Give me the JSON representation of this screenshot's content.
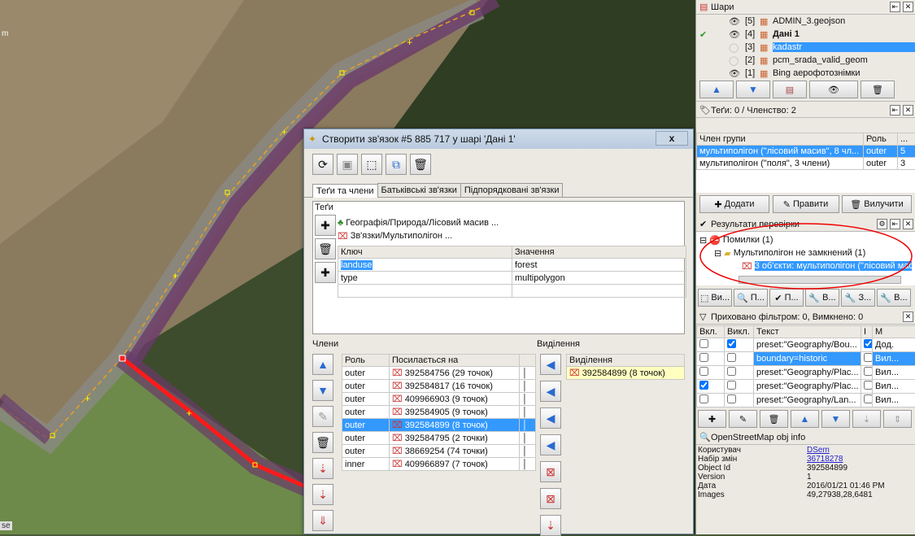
{
  "map": {
    "scale_label": "m",
    "scale_label2": "se"
  },
  "layers": {
    "title": "Шари",
    "items": [
      {
        "index": "[5]",
        "name": "ADMIN_3.geojson",
        "visible": true,
        "active": false
      },
      {
        "index": "[4]",
        "name": "Дані 1",
        "visible": true,
        "active": true
      },
      {
        "index": "[3]",
        "name": "kadastr",
        "visible": false,
        "active": false,
        "selected": true
      },
      {
        "index": "[2]",
        "name": "pcm_srada_valid_geom",
        "visible": false,
        "active": false
      },
      {
        "index": "[1]",
        "name": "Bing аерофотознімки",
        "visible": true,
        "active": false
      }
    ]
  },
  "relation_panel": {
    "title": "Теґи: 0 / Членство: 2",
    "col_member": "Член групи",
    "col_role": "Роль",
    "col_more": "...",
    "rows": [
      {
        "member": "мультиполігон (\"лісовий масив\", 8 чл...",
        "role": "outer",
        "n": "5",
        "selected": true
      },
      {
        "member": "мультиполігон (\"поля\", 3 члени)",
        "role": "outer",
        "n": "3",
        "selected": false
      }
    ],
    "add": "Додати",
    "edit": "Правити",
    "remove": "Вилучити"
  },
  "validation": {
    "title": "Результати перевірки",
    "errors": "Помилки (1)",
    "group": "Мультиполігон не замкнений (1)",
    "item": "3 об'єкти: мультиполігон (\"лісовий мас",
    "buttons": [
      "Ви...",
      "П...",
      "П...",
      "В...",
      "З...",
      "В..."
    ]
  },
  "filters": {
    "title": "Приховано фільтром: 0, Вимкнено: 0",
    "col_on": "Вкл.",
    "col_off": "Викл.",
    "col_text": "Текст",
    "col_i": "I",
    "col_m": "M",
    "rows": [
      {
        "on": false,
        "off": true,
        "text": "preset:\"Geography/Bou...",
        "i": true,
        "m": "Дод.",
        "selected": false
      },
      {
        "on": false,
        "off": false,
        "text": "boundary=historic",
        "i": false,
        "m": "Вил...",
        "selected": true
      },
      {
        "on": false,
        "off": false,
        "text": "preset:\"Geography/Plac...",
        "i": false,
        "m": "Вил...",
        "selected": false
      },
      {
        "on": true,
        "off": false,
        "text": "preset:\"Geography/Plac...",
        "i": false,
        "m": "Вил...",
        "selected": false
      },
      {
        "on": false,
        "off": false,
        "text": "preset:\"Geography/Lan...",
        "i": false,
        "m": "Вил...",
        "selected": false
      }
    ]
  },
  "objinfo": {
    "title": "OpenStreetMap obj info",
    "rows": [
      {
        "k": "Користувач",
        "v": "DSem",
        "link": true
      },
      {
        "k": "Набір змін",
        "v": "36718278",
        "link": true
      },
      {
        "k": "Object Id",
        "v": "392584899",
        "link": false
      },
      {
        "k": "Version",
        "v": "1",
        "link": false
      },
      {
        "k": "Дата",
        "v": "2016/01/21 01:46 PM",
        "link": false
      },
      {
        "k": "Images",
        "v": "49,27938,28,6481",
        "link": false
      }
    ]
  },
  "dialog": {
    "title": "Створити зв'язок #5 885 717 у шарі 'Дані 1'",
    "close": "x",
    "tabs": [
      "Теґи та члени",
      "Батьківські зв'язки",
      "Підпорядковані зв'язки"
    ],
    "tags_label": "Теґи",
    "presets": [
      "Географія/Природа/Лісовий масив ...",
      "Зв'язки/Мультиполігон ..."
    ],
    "col_key": "Ключ",
    "col_value": "Значення",
    "tags": [
      {
        "key": "landuse",
        "value": "forest"
      },
      {
        "key": "type",
        "value": "multipolygon"
      },
      {
        "key": "",
        "value": ""
      }
    ],
    "members_label": "Члени",
    "selection_label": "Виділення",
    "col_role": "Роль",
    "col_ref": "Посилається на",
    "members": [
      {
        "role": "outer",
        "ref": "392584756 (29 точок)",
        "selected": false
      },
      {
        "role": "outer",
        "ref": "392584817 (16 точок)",
        "selected": false
      },
      {
        "role": "outer",
        "ref": "409966903 (9 точок)",
        "selected": false
      },
      {
        "role": "outer",
        "ref": "392584905 (9 точок)",
        "selected": false
      },
      {
        "role": "outer",
        "ref": "392584899 (8 точок)",
        "selected": true
      },
      {
        "role": "outer",
        "ref": "392584795 (2 точки)",
        "selected": false
      },
      {
        "role": "outer",
        "ref": "38669254 (74 точки)",
        "selected": false
      },
      {
        "role": "inner",
        "ref": "409966897 (7 точок)",
        "selected": false
      }
    ],
    "col_selection": "Виділення",
    "selection": [
      "392584899 (8 точок)"
    ]
  }
}
